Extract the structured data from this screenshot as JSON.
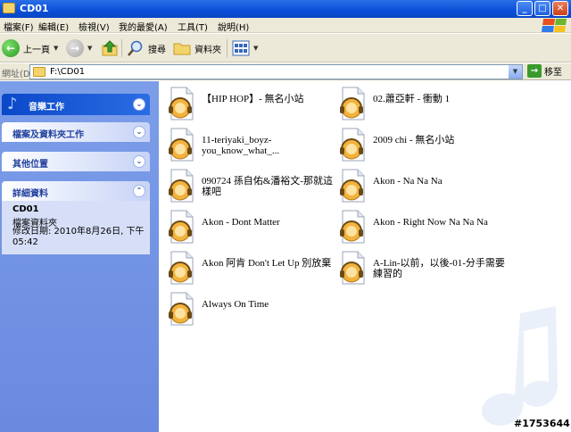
{
  "window": {
    "title": "CD01"
  },
  "menu": [
    "檔案(F)",
    "編輯(E)",
    "檢視(V)",
    "我的最愛(A)",
    "工具(T)",
    "說明(H)"
  ],
  "toolbar": {
    "back": "上一頁",
    "search": "搜尋",
    "folders": "資料夾"
  },
  "address": {
    "label": "網址(D)",
    "path": "F:\\CD01",
    "go": "移至"
  },
  "taskpane": {
    "music_tasks": "音樂工作",
    "file_folder_tasks": "檔案及資料夾工作",
    "other_places": "其他位置",
    "details": "詳細資料",
    "detail_name": "CD01",
    "detail_type": "檔案資料夾",
    "detail_modified": "修改日期: 2010年8月26日, 下午 05:42"
  },
  "files": [
    "【HIP HOP】- 無名小站",
    "02.蕭亞軒 - 衝動 1",
    "11-teriyaki_boyz-you_know_what_...",
    "2009 chi - 無名小站",
    "090724 孫自佑&潘裕文-那就這樣吧",
    "Akon - Na Na Na",
    "Akon - Dont Matter",
    "Akon - Right Now Na Na Na",
    "Akon 阿肯 Don't Let Up 別放棄",
    "A-Lin-以前，以後-01-分手需要練習的",
    "Always On Time"
  ],
  "watermark": "#1753644",
  "colors": {
    "title_bar": "#0a4fd8",
    "task_pane": "#6a8adf",
    "chrome": "#ece9d8"
  }
}
